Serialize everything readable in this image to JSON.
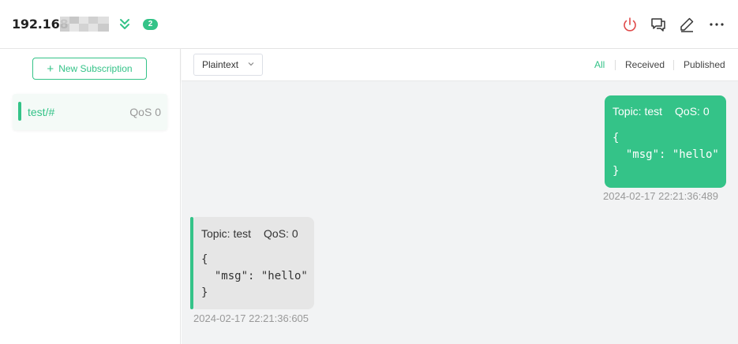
{
  "header": {
    "connection_name": "192.168",
    "new_count": "2",
    "colors": {
      "accent": "#34c388",
      "disconnect": "#e04a4a"
    },
    "icons": [
      "chevrons-down-icon",
      "power-icon",
      "message-icon",
      "edit-icon",
      "more-icon"
    ]
  },
  "sidebar": {
    "new_subscription_label": "New Subscription",
    "subscriptions": [
      {
        "topic": "test/#",
        "qos": "QoS 0",
        "color": "#34c388"
      }
    ]
  },
  "filter": {
    "format": "Plaintext",
    "tabs": [
      "All",
      "Received",
      "Published"
    ],
    "active_tab": "All"
  },
  "messages": [
    {
      "direction": "published",
      "topic_label": "Topic: test",
      "qos_label": "QoS: 0",
      "payload": "{\n  \"msg\": \"hello\"\n}",
      "timestamp": "2024-02-17 22:21:36:489"
    },
    {
      "direction": "received",
      "topic_label": "Topic: test",
      "qos_label": "QoS: 0",
      "payload": "{\n  \"msg\": \"hello\"\n}",
      "timestamp": "2024-02-17 22:21:36:605"
    }
  ]
}
